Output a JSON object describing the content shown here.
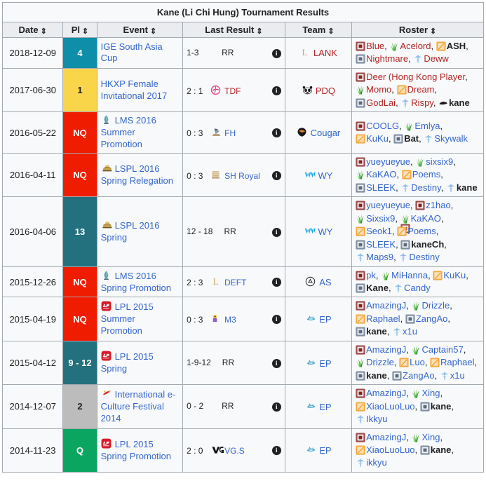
{
  "table": {
    "title": "Kane (Li Chi Hung) Tournament Results",
    "columns": [
      {
        "key": "date",
        "label": "Date"
      },
      {
        "key": "place",
        "label": "Pl"
      },
      {
        "key": "event",
        "label": "Event"
      },
      {
        "key": "result",
        "label": "Last Result"
      },
      {
        "key": "team",
        "label": "Team"
      },
      {
        "key": "roster",
        "label": "Roster"
      }
    ],
    "sort_glyph": "⇕",
    "info_glyph": "i",
    "placement_colors": {
      "teal_bright": "#0e8ea8",
      "teal_dark": "#23707e",
      "gold": "#f9d54a",
      "red": "#f01c00",
      "grey": "#bcbcbc",
      "green": "#0aa561"
    },
    "rows": [
      {
        "date": "2018-12-09",
        "place": "4",
        "place_color": "#0e8ea8",
        "place_text_color": "#ffffff",
        "event": "IGE South Asia Cup",
        "event_icon": "none",
        "score": "1-3",
        "opponent": "RR",
        "opponent_icon": "none",
        "opponent_color": "dark",
        "team": "LANK",
        "team_icon": "lank-logo",
        "team_color": "red",
        "roster": [
          {
            "role": "top",
            "name": "Blue",
            "color": "red",
            "bold": false
          },
          {
            "role": "jungle",
            "name": "Acelord",
            "color": "red",
            "bold": false
          },
          {
            "role": "mid",
            "name": "ASH",
            "color": "dark",
            "bold": true
          },
          {
            "role": "bot",
            "name": "Nightmare",
            "color": "red",
            "bold": false
          },
          {
            "role": "support",
            "name": "Deww",
            "color": "red",
            "bold": false
          }
        ]
      },
      {
        "date": "2017-06-30",
        "place": "1",
        "place_color": "#f9d54a",
        "place_text_color": "#202122",
        "event": "HKXP Female Invitational 2017",
        "event_icon": "none",
        "score": "2 : 1",
        "opponent": "TDF",
        "opponent_icon": "tdf-logo",
        "opponent_color": "red",
        "team": "PDQ",
        "team_icon": "pdq-logo",
        "team_color": "red",
        "roster": [
          {
            "role": "top",
            "name": "Deer (Hong Kong Player",
            "color": "red",
            "bold": false
          },
          {
            "role": "jungle",
            "name": "Momo",
            "color": "red",
            "bold": false
          },
          {
            "role": "mid",
            "name": "Dream",
            "color": "red",
            "bold": false
          },
          {
            "role": "bot",
            "name": "GodLai",
            "color": "red",
            "bold": false
          },
          {
            "role": "support",
            "name": "Rispy",
            "color": "red",
            "bold": false
          },
          {
            "role": "coach",
            "name": "kane",
            "color": "dark",
            "bold": true
          }
        ]
      },
      {
        "date": "2016-05-22",
        "place": "NQ",
        "place_color": "#f01c00",
        "place_text_color": "#ffffff",
        "event": "LMS 2016 Summer Promotion",
        "event_icon": "lms-logo",
        "score": "0 : 3",
        "opponent": "FH",
        "opponent_icon": "fh-logo",
        "opponent_color": "blue",
        "team": "Cougar",
        "team_icon": "cougar-logo",
        "team_color": "blue",
        "roster": [
          {
            "role": "top",
            "name": "COOLG",
            "color": "blue",
            "bold": false
          },
          {
            "role": "jungle",
            "name": "Emlya",
            "color": "blue",
            "bold": false
          },
          {
            "role": "mid",
            "name": "KuKu",
            "color": "blue",
            "bold": false
          },
          {
            "role": "bot",
            "name": "Bat",
            "color": "dark",
            "bold": true
          },
          {
            "role": "support",
            "name": "Skywalk",
            "color": "blue",
            "bold": false
          }
        ]
      },
      {
        "date": "2016-04-11",
        "place": "NQ",
        "place_color": "#f01c00",
        "place_text_color": "#ffffff",
        "event": "LSPL 2016 Spring Relegation",
        "event_icon": "lspl-logo",
        "score": "0 : 3",
        "opponent": "SH Royal",
        "opponent_icon": "shroyal-logo",
        "opponent_color": "blue",
        "team": "WY",
        "team_icon": "wy-logo",
        "team_color": "blue",
        "roster": [
          {
            "role": "top",
            "name": "yueyueyue",
            "color": "blue",
            "bold": false
          },
          {
            "role": "jungle",
            "name": "sixsix9",
            "color": "blue",
            "bold": false
          },
          {
            "role": "jungle",
            "name": "KaKAO",
            "color": "blue",
            "bold": false
          },
          {
            "role": "mid",
            "name": "Poems",
            "color": "blue",
            "bold": false
          },
          {
            "role": "bot",
            "name": "SLEEK",
            "color": "blue",
            "bold": false
          },
          {
            "role": "support",
            "name": "Destiny",
            "color": "blue",
            "bold": false
          },
          {
            "role": "support",
            "name": "kane",
            "color": "dark",
            "bold": true
          }
        ]
      },
      {
        "date": "2016-04-06",
        "place": "13",
        "place_color": "#23707e",
        "place_text_color": "#ffffff",
        "event": "LSPL 2016 Spring",
        "event_icon": "lspl-logo",
        "score": "12 - 18",
        "opponent": "RR",
        "opponent_icon": "none",
        "opponent_color": "dark",
        "team": "WY",
        "team_icon": "wy-logo",
        "team_color": "blue",
        "roster": [
          {
            "role": "top",
            "name": "yueyueyue",
            "color": "blue",
            "bold": false
          },
          {
            "role": "top",
            "name": "z1hao",
            "color": "blue",
            "bold": false
          },
          {
            "role": "jungle",
            "name": "Sixsix9",
            "color": "blue",
            "bold": false
          },
          {
            "role": "jungle-top",
            "name": "KaKAO",
            "color": "blue",
            "bold": false
          },
          {
            "role": "mid",
            "name": "Seok1",
            "color": "blue",
            "bold": false
          },
          {
            "role": "mid",
            "name": "Poems",
            "color": "blue",
            "bold": false
          },
          {
            "role": "bot",
            "name": "SLEEK",
            "color": "blue",
            "bold": false
          },
          {
            "role": "bot",
            "name": "kaneCh",
            "color": "dark",
            "bold": true
          },
          {
            "role": "support",
            "name": "Maps9",
            "color": "blue",
            "bold": false
          },
          {
            "role": "support",
            "name": "Destiny",
            "color": "blue",
            "bold": false
          }
        ]
      },
      {
        "date": "2015-12-26",
        "place": "NQ",
        "place_color": "#f01c00",
        "place_text_color": "#ffffff",
        "event": "LMS 2016 Spring Promotion",
        "event_icon": "lms-logo",
        "score": "2 : 3",
        "opponent": "DEFT",
        "opponent_icon": "deft-logo",
        "opponent_color": "blue",
        "team": "AS",
        "team_icon": "as-logo",
        "team_color": "blue",
        "roster": [
          {
            "role": "top",
            "name": "pk",
            "color": "blue",
            "bold": false
          },
          {
            "role": "jungle",
            "name": "MiHanna",
            "color": "blue",
            "bold": false
          },
          {
            "role": "mid",
            "name": "KuKu",
            "color": "blue",
            "bold": false
          },
          {
            "role": "bot",
            "name": "Kane",
            "color": "dark",
            "bold": true
          },
          {
            "role": "support",
            "name": "Candy",
            "color": "blue",
            "bold": false
          }
        ]
      },
      {
        "date": "2015-04-19",
        "place": "NQ",
        "place_color": "#f01c00",
        "place_text_color": "#ffffff",
        "event": "LPL 2015 Summer Promotion",
        "event_icon": "lpl-logo",
        "score": "0 : 3",
        "opponent": "M3",
        "opponent_icon": "m3-logo",
        "opponent_color": "blue",
        "team": "EP",
        "team_icon": "ep-logo",
        "team_color": "blue",
        "roster": [
          {
            "role": "top",
            "name": "AmazingJ",
            "color": "blue",
            "bold": false
          },
          {
            "role": "jungle",
            "name": "Drizzle",
            "color": "blue",
            "bold": false
          },
          {
            "role": "mid",
            "name": "Raphael",
            "color": "blue",
            "bold": false
          },
          {
            "role": "bot",
            "name": "ZangAo",
            "color": "blue",
            "bold": false
          },
          {
            "role": "bot",
            "name": "kane",
            "color": "dark",
            "bold": true
          },
          {
            "role": "support",
            "name": "x1u",
            "color": "blue",
            "bold": false
          }
        ]
      },
      {
        "date": "2015-04-12",
        "place": "9 - 12",
        "place_color": "#23707e",
        "place_text_color": "#ffffff",
        "event": "LPL 2015 Spring",
        "event_icon": "lpl-logo",
        "score": "1-9-12",
        "opponent": "RR",
        "opponent_icon": "none",
        "opponent_color": "dark",
        "team": "EP",
        "team_icon": "ep-logo",
        "team_color": "blue",
        "roster": [
          {
            "role": "top",
            "name": "AmazingJ",
            "color": "blue",
            "bold": false
          },
          {
            "role": "jungle",
            "name": "Captain57",
            "color": "blue",
            "bold": false
          },
          {
            "role": "jungle",
            "name": "Drizzle",
            "color": "blue",
            "bold": false
          },
          {
            "role": "mid",
            "name": "Luo",
            "color": "blue",
            "bold": false
          },
          {
            "role": "mid",
            "name": "Raphael",
            "color": "blue",
            "bold": false
          },
          {
            "role": "bot",
            "name": "kane",
            "color": "dark",
            "bold": true
          },
          {
            "role": "bot",
            "name": "ZangAo",
            "color": "blue",
            "bold": false
          },
          {
            "role": "support",
            "name": "x1u",
            "color": "blue",
            "bold": false
          }
        ]
      },
      {
        "date": "2014-12-07",
        "place": "2",
        "place_color": "#bcbcbc",
        "place_text_color": "#202122",
        "event": "International e-Culture Festival 2014",
        "event_icon": "iecf-logo",
        "score": "0 - 2",
        "opponent": "RR",
        "opponent_icon": "none",
        "opponent_color": "dark",
        "team": "EP",
        "team_icon": "ep-logo",
        "team_color": "blue",
        "roster": [
          {
            "role": "top",
            "name": "AmazingJ",
            "color": "blue",
            "bold": false
          },
          {
            "role": "jungle",
            "name": "Xing",
            "color": "blue",
            "bold": false
          },
          {
            "role": "mid",
            "name": "XiaoLuoLuo",
            "color": "blue",
            "bold": false
          },
          {
            "role": "bot",
            "name": "kane",
            "color": "dark",
            "bold": true
          },
          {
            "role": "support",
            "name": "Ikkyu",
            "color": "blue",
            "bold": false
          }
        ]
      },
      {
        "date": "2014-11-23",
        "place": "Q",
        "place_color": "#0aa561",
        "place_text_color": "#ffffff",
        "event": "LPL 2015 Spring Promotion",
        "event_icon": "lpl-logo",
        "score": "2 : 0",
        "opponent": "VG.S",
        "opponent_icon": "vg-logo",
        "opponent_color": "blue",
        "team": "EP",
        "team_icon": "ep-logo",
        "team_color": "blue",
        "roster": [
          {
            "role": "top",
            "name": "AmazingJ",
            "color": "blue",
            "bold": false
          },
          {
            "role": "jungle",
            "name": "Xing",
            "color": "blue",
            "bold": false
          },
          {
            "role": "mid",
            "name": "XiaoLuoLuo",
            "color": "blue",
            "bold": false
          },
          {
            "role": "bot",
            "name": "kane",
            "color": "dark",
            "bold": true
          },
          {
            "role": "support",
            "name": "ikkyu",
            "color": "blue",
            "bold": false
          }
        ]
      }
    ]
  }
}
